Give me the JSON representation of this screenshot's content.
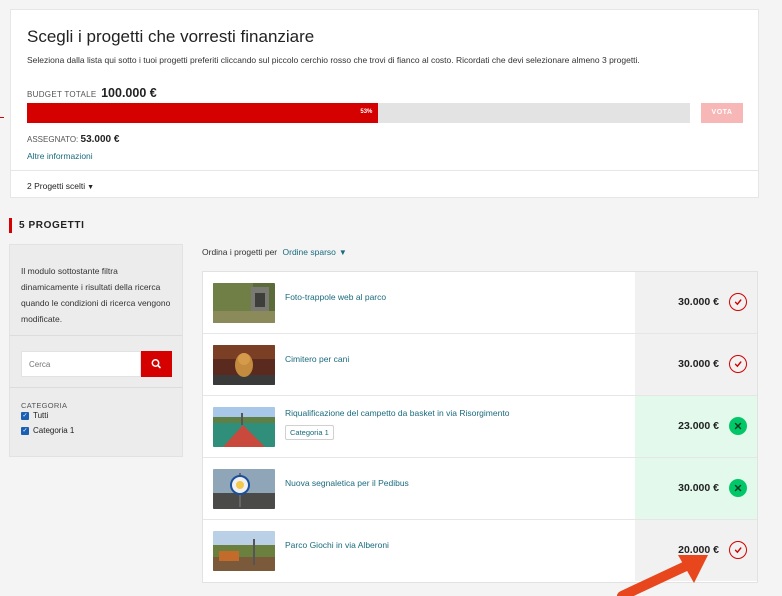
{
  "header": {
    "title": "Scegli i progetti che vorresti finanziare",
    "subtitle": "Seleziona dalla lista qui sotto i tuoi progetti preferiti cliccando sul piccolo cerchio rosso che trovi di fianco al costo. Ricordati che devi selezionare almeno 3 progetti.",
    "budget_label": "BUDGET TOTALE",
    "budget_value": "100.000 €",
    "progress_percent": 53,
    "progress_label": "53%",
    "vote_button": "VOTA",
    "assigned_label": "ASSEGNATO:",
    "assigned_value": "53.000 €",
    "more_info_link": "Altre informazioni",
    "chosen_projects": "2 Progetti scelti"
  },
  "projects_count": "5 PROGETTI",
  "filter": {
    "description": "Il modulo sottostante filtra dinamicamente i risultati della ricerca quando le condizioni di ricerca vengono modificate.",
    "search_placeholder": "Cerca",
    "search_icon": "search-icon",
    "category_label": "CATEGORIA",
    "options": [
      {
        "label": "Tutti",
        "checked": true
      },
      {
        "label": "Categoria 1",
        "checked": true
      }
    ]
  },
  "sort": {
    "label": "Ordina i progetti per",
    "value": "Ordine sparso"
  },
  "projects": [
    {
      "name": "Foto-trappole web al parco",
      "tag": "",
      "price": "30.000 €",
      "selected": false
    },
    {
      "name": "Cimitero per cani",
      "tag": "",
      "price": "30.000 €",
      "selected": false
    },
    {
      "name": "Riqualificazione del campetto da basket in via Risorgimento",
      "tag": "Categoria 1",
      "price": "23.000 €",
      "selected": true
    },
    {
      "name": "Nuova segnaletica per il Pedibus",
      "tag": "",
      "price": "30.000 €",
      "selected": true
    },
    {
      "name": "Parco Giochi in via Alberoni",
      "tag": "",
      "price": "20.000 €",
      "selected": false
    }
  ],
  "colors": {
    "accent": "#d50000",
    "link": "#1a6b7d",
    "selected_bg": "#e3f9ec",
    "selected_icon": "#00c767"
  }
}
